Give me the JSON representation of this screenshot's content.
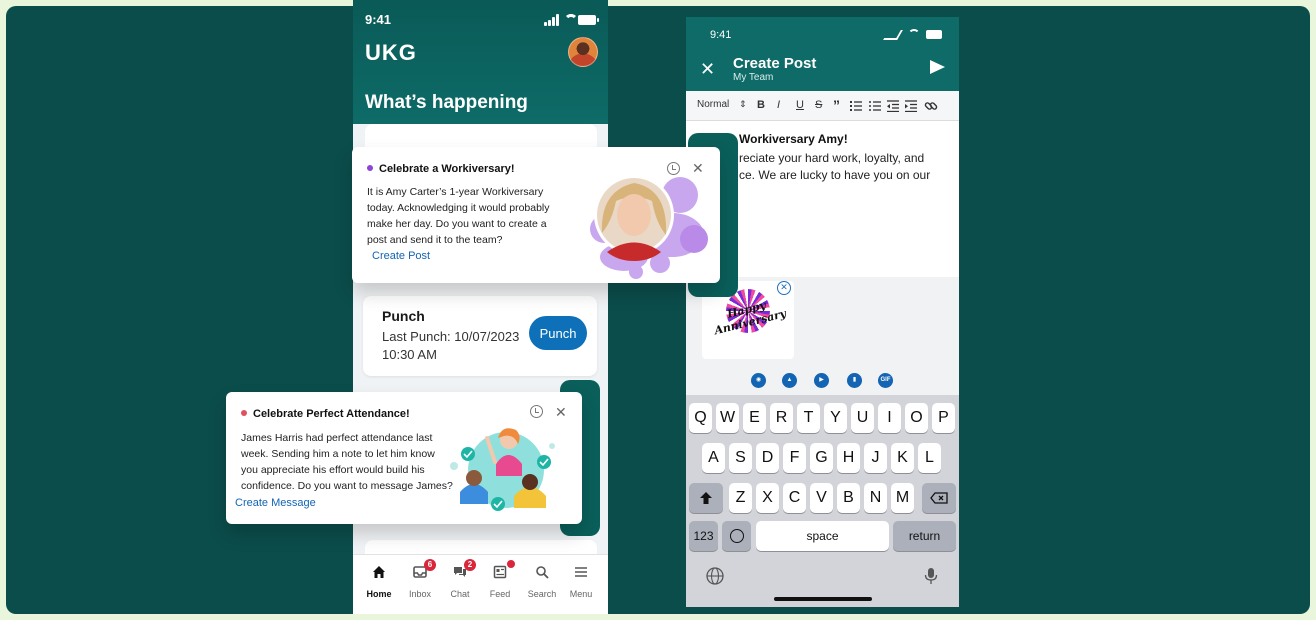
{
  "colors": {
    "teal_dark": "#0b4d4b",
    "teal_header": "#0f6b68",
    "accent_blue": "#0e70b8",
    "link_blue": "#1364b3",
    "badge_red": "#d9263a",
    "purple": "#8e44d8"
  },
  "home_phone": {
    "status_time": "9:41",
    "logo": "UKG",
    "heading": "What’s happening",
    "punch": {
      "title": "Punch",
      "last_punch": "Last Punch: 10/07/2023",
      "time": "10:30 AM",
      "button": "Punch"
    },
    "tabs": [
      {
        "label": "Home",
        "icon": "home-icon",
        "badge": ""
      },
      {
        "label": "Inbox",
        "icon": "inbox-icon",
        "badge": "6"
      },
      {
        "label": "Chat",
        "icon": "chat-icon",
        "badge": "2"
      },
      {
        "label": "Feed",
        "icon": "feed-icon",
        "badge": ""
      },
      {
        "label": "Search",
        "icon": "search-icon",
        "badge": ""
      },
      {
        "label": "Menu",
        "icon": "menu-icon",
        "badge": ""
      }
    ]
  },
  "workiversary_card": {
    "title": "Celebrate a Workiversary!",
    "lines": [
      "It is Amy Carter’s 1-year Workiversary",
      "today. Acknowledging it would probably",
      "make her day. Do you want to create a",
      "post and send it to the team?"
    ],
    "action": "Create Post"
  },
  "attendance_card": {
    "title": "Celebrate Perfect Attendance!",
    "lines": [
      "James Harris had perfect attendance last",
      "week. Sending him a note to let him know",
      "you appreciate his effort would build his",
      "confidence. Do you want to message James?"
    ],
    "action": "Create Message"
  },
  "post_phone": {
    "status_time": "9:41",
    "title": "Create Post",
    "subtitle": "My Team",
    "toolbar": {
      "style": "Normal",
      "bold": "B",
      "italic": "I",
      "underline": "U",
      "strike": "S",
      "quote": "”"
    },
    "editor": {
      "heading": "Workiversary Amy!",
      "line1": "reciate your hard work, loyalty, and",
      "line2": "ce. We are lucky to have you on our"
    },
    "sticker_text": "Happy Anniversary",
    "media_gif": "GIF",
    "keyboard": {
      "row1": [
        "Q",
        "W",
        "E",
        "R",
        "T",
        "Y",
        "U",
        "I",
        "O",
        "P"
      ],
      "row2": [
        "A",
        "S",
        "D",
        "F",
        "G",
        "H",
        "J",
        "K",
        "L"
      ],
      "row3": [
        "Z",
        "X",
        "C",
        "V",
        "B",
        "N",
        "M"
      ],
      "numbers": "123",
      "space": "space",
      "return": "return"
    }
  }
}
